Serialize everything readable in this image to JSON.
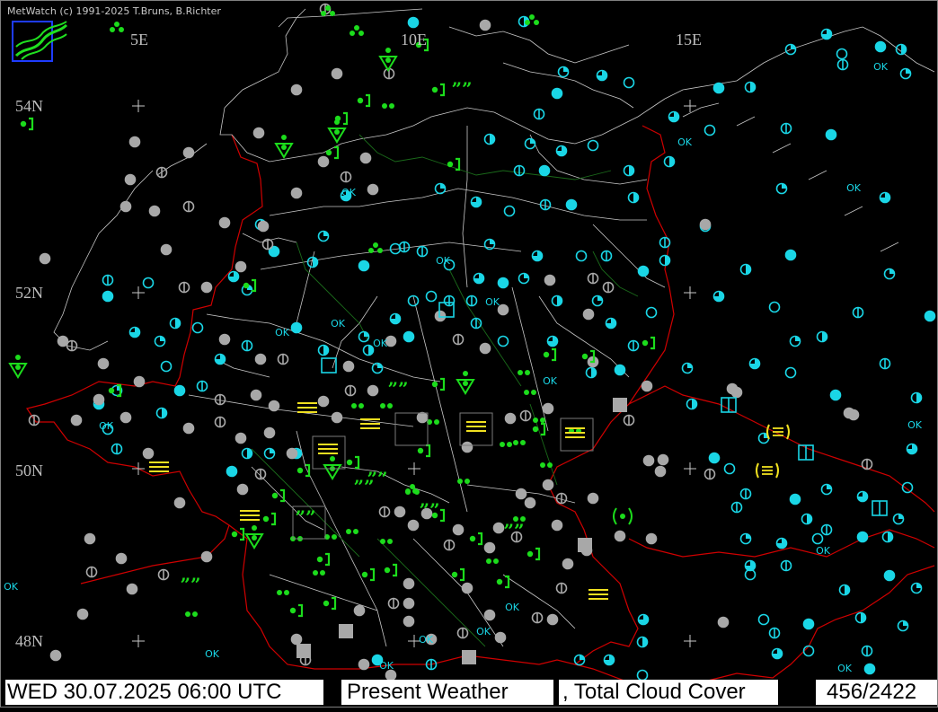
{
  "header": {
    "copyright": "MetWatch  (c) 1991-2025 T.Bruns, B.Richter"
  },
  "labels": {
    "lon_5e": "5E",
    "lon_10e": "10E",
    "lon_15e": "15E",
    "lat_54n": "54N",
    "lat_52n": "52N",
    "lat_50n": "50N",
    "lat_48n": "48N"
  },
  "status_bar": {
    "datetime": "WED 30.07.2025 06:00 UTC",
    "product_1": "Present Weather",
    "product_2": ", Total Cloud Cover",
    "counter": "456/2422"
  },
  "station_marks": {
    "ok": "OK"
  },
  "colors": {
    "background": "#000000",
    "border_red": "#d00000",
    "coast_white": "#cfcfcf",
    "river_green": "#1a6a1a",
    "cloud_cyan": "#1ad6e6",
    "cloud_gray": "#a8a8a8",
    "rain_green": "#1cdc1c",
    "fog_yellow": "#f0e020"
  }
}
